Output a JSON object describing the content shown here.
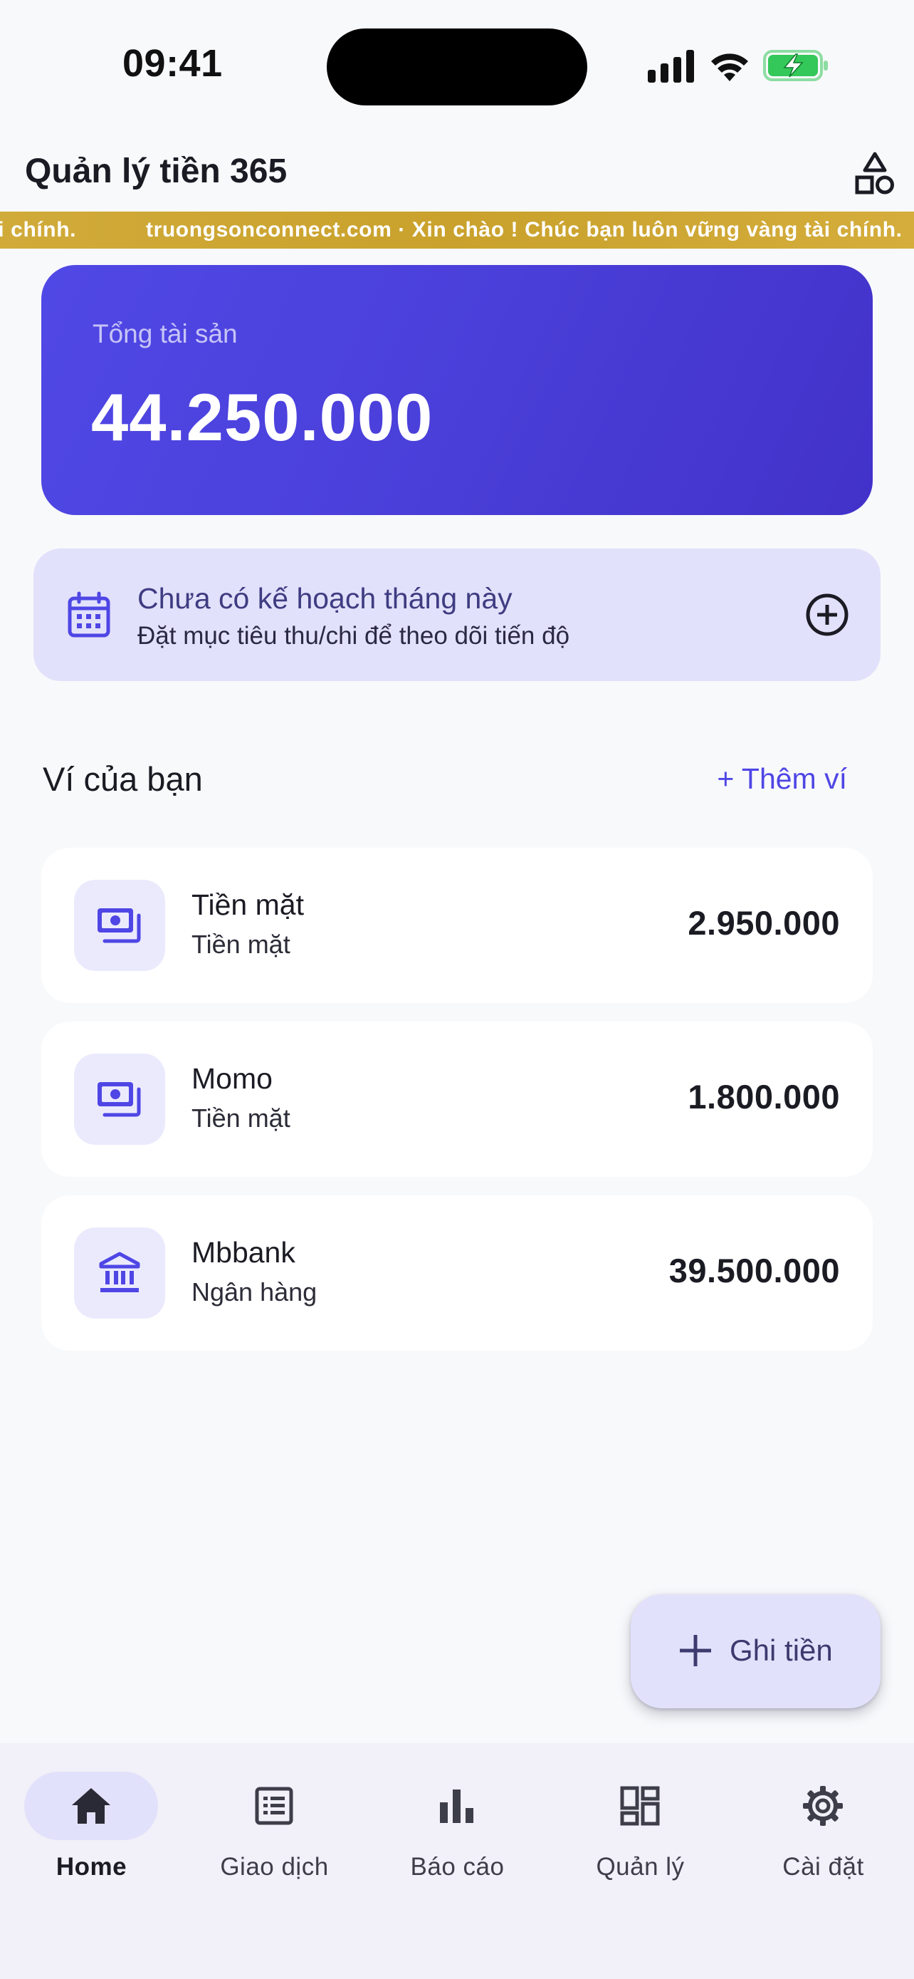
{
  "status_bar": {
    "time": "09:41"
  },
  "app_bar": {
    "title": "Quản lý tiền 365"
  },
  "marquee": {
    "text_tail": "ài chính.",
    "text": "truongsonconnect.com · Xin chào ! Chúc bạn luôn vững vàng tài chính."
  },
  "total": {
    "label": "Tổng tài sản",
    "value": "44.250.000"
  },
  "plan": {
    "title": "Chưa có kế hoạch tháng này",
    "subtitle": "Đặt mục tiêu thu/chi để theo dõi tiến độ"
  },
  "wallets_section": {
    "title": "Ví của bạn",
    "add_label": "+ Thêm ví"
  },
  "wallets": [
    {
      "name": "Tiền mặt",
      "type": "Tiền mặt",
      "amount": "2.950.000",
      "icon": "cash-icon"
    },
    {
      "name": "Momo",
      "type": "Tiền mặt",
      "amount": "1.800.000",
      "icon": "cash-icon"
    },
    {
      "name": "Mbbank",
      "type": "Ngân hàng",
      "amount": "39.500.000",
      "icon": "bank-icon"
    }
  ],
  "fab": {
    "label": "Ghi tiền"
  },
  "nav": [
    {
      "label": "Home",
      "icon": "home-icon",
      "active": true
    },
    {
      "label": "Giao dịch",
      "icon": "list-icon",
      "active": false
    },
    {
      "label": "Báo cáo",
      "icon": "bar-chart-icon",
      "active": false
    },
    {
      "label": "Quản lý",
      "icon": "dashboard-icon",
      "active": false
    },
    {
      "label": "Cài đặt",
      "icon": "gear-icon",
      "active": false
    }
  ],
  "colors": {
    "accent": "#4f46e5",
    "card_gradient_start": "#5048e6",
    "card_gradient_end": "#4232c9",
    "marquee_gold": "#c9a12c",
    "tint": "#e2e1fb",
    "battery_green": "#34c759"
  }
}
